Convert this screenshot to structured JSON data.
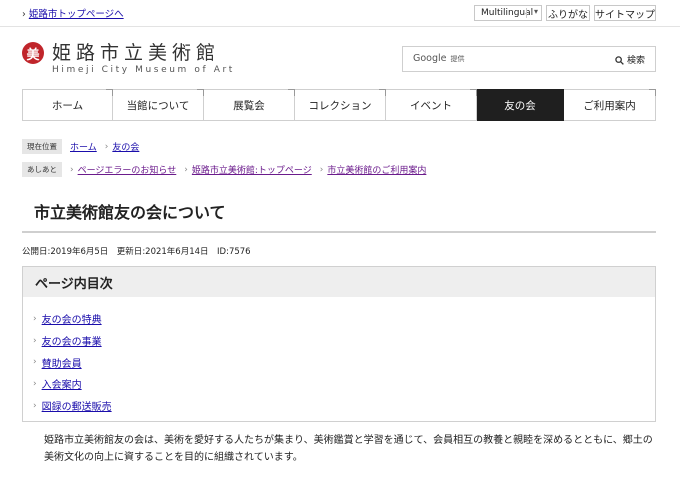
{
  "topbar": {
    "home_link": "姫路市トップページへ",
    "multilingual": "Multilingual",
    "furigana": "ふりがな",
    "sitemap": "サイトマップ"
  },
  "header": {
    "logo_mark": "美",
    "title": "姫路市立美術館",
    "subtitle": "Himeji City Museum of Art"
  },
  "search": {
    "brand": "Google",
    "brand_suffix": "提供",
    "button": "検索"
  },
  "nav": [
    {
      "label": "ホーム",
      "active": false
    },
    {
      "label": "当館について",
      "active": false
    },
    {
      "label": "展覧会",
      "active": false
    },
    {
      "label": "コレクション",
      "active": false
    },
    {
      "label": "イベント",
      "active": false
    },
    {
      "label": "友の会",
      "active": true
    },
    {
      "label": "ご利用案内",
      "active": false
    }
  ],
  "breadcrumb": {
    "tag": "現在位置",
    "items": [
      "ホーム",
      "友の会"
    ]
  },
  "history": {
    "tag": "あしあと",
    "items": [
      "ページエラーのお知らせ",
      "姫路市立美術館:トップページ",
      "市立美術館のご利用案内"
    ]
  },
  "page": {
    "title": "市立美術館友の会について",
    "meta": "公開日:2019年6月5日　更新日:2021年6月14日　ID:7576"
  },
  "toc": {
    "heading": "ページ内目次",
    "items": [
      "友の会の特典",
      "友の会の事業",
      "賛助会員",
      "入会案内",
      "図録の郵送販売"
    ]
  },
  "body": {
    "paragraph": "姫路市立美術館友の会は、美術を愛好する人たちが集まり、美術鑑賞と学習を通じて、会員相互の教養と親睦を深めるとともに、郷土の美術文化の向上に資することを目的に組織されています。"
  },
  "colors": {
    "brand_red": "#c0252b",
    "link": "#1a0dab",
    "visited": "#6b1b8c",
    "nav_active": "#1f1f1f"
  }
}
